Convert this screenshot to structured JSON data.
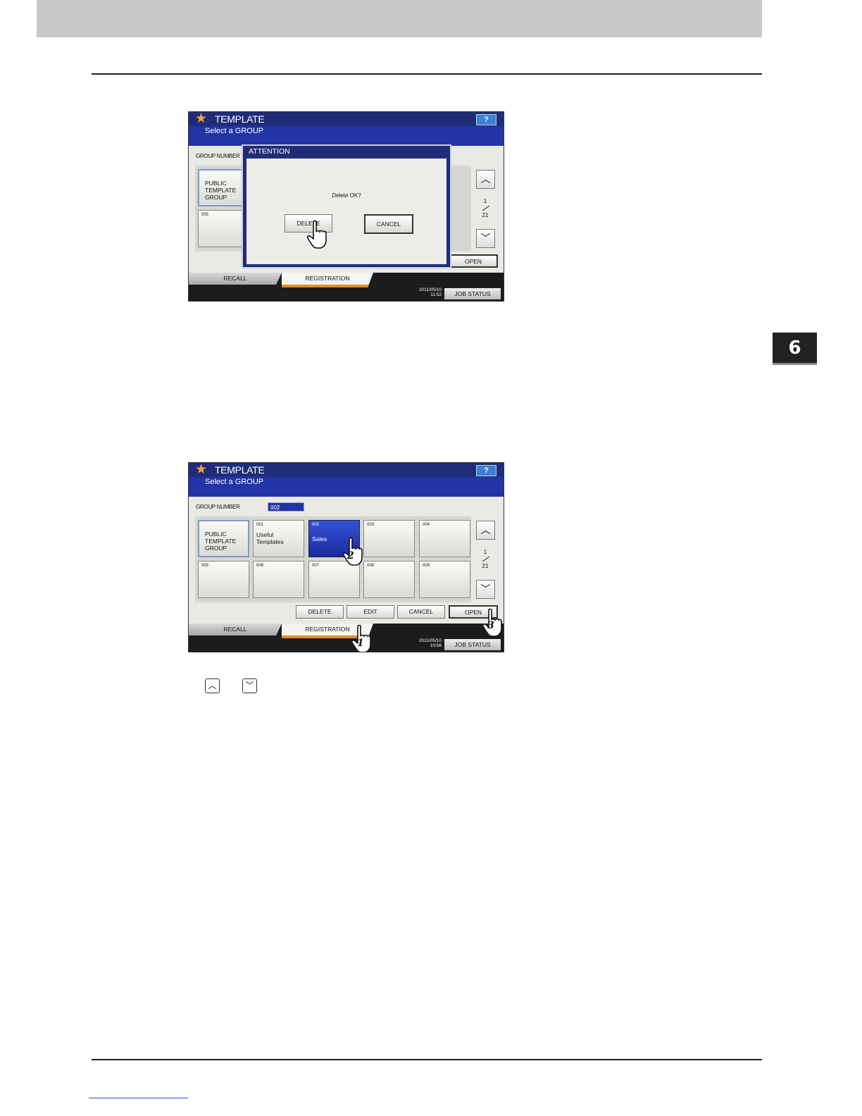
{
  "chapter": {
    "number": "6"
  },
  "screen1": {
    "title": "TEMPLATE",
    "subtitle": "Select a GROUP",
    "help_label": "?",
    "group_number_label": "GROUP NUMBER",
    "tiles": [
      {
        "num": "",
        "label": "PUBLIC\nTEMPLATE\nGROUP"
      },
      {
        "num": "005",
        "label": ""
      }
    ],
    "page": {
      "current": "1",
      "total": "21"
    },
    "open_label": "OPEN",
    "tabs": {
      "recall": "RECALL",
      "registration": "REGISTRATION"
    },
    "clock": {
      "date": "2011/05/10",
      "time": "11:52"
    },
    "job_status": "JOB STATUS",
    "dialog": {
      "title": "ATTENTION",
      "message": "Delete OK?",
      "delete_label": "DELETE",
      "cancel_label": "CANCEL"
    }
  },
  "screen2": {
    "title": "TEMPLATE",
    "subtitle": "Select a GROUP",
    "help_label": "?",
    "group_number_label": "GROUP NUMBER",
    "group_number_value": "002",
    "tiles": [
      {
        "num": "",
        "label": "PUBLIC\nTEMPLATE\nGROUP"
      },
      {
        "num": "001",
        "label": "Useful\nTemplates"
      },
      {
        "num": "002",
        "label": "Sales"
      },
      {
        "num": "003",
        "label": ""
      },
      {
        "num": "004",
        "label": ""
      },
      {
        "num": "005",
        "label": ""
      },
      {
        "num": "006",
        "label": ""
      },
      {
        "num": "007",
        "label": ""
      },
      {
        "num": "008",
        "label": ""
      },
      {
        "num": "009",
        "label": ""
      }
    ],
    "page": {
      "current": "1",
      "total": "21"
    },
    "actions": {
      "delete": "DELETE",
      "edit": "EDIT",
      "cancel": "CANCEL",
      "open": "OPEN"
    },
    "tabs": {
      "recall": "RECALL",
      "registration": "REGISTRATION"
    },
    "clock": {
      "date": "2011/05/10",
      "time": "10:56"
    },
    "job_status": "JOB STATUS",
    "step_markers": [
      "1",
      "2",
      "3"
    ]
  }
}
